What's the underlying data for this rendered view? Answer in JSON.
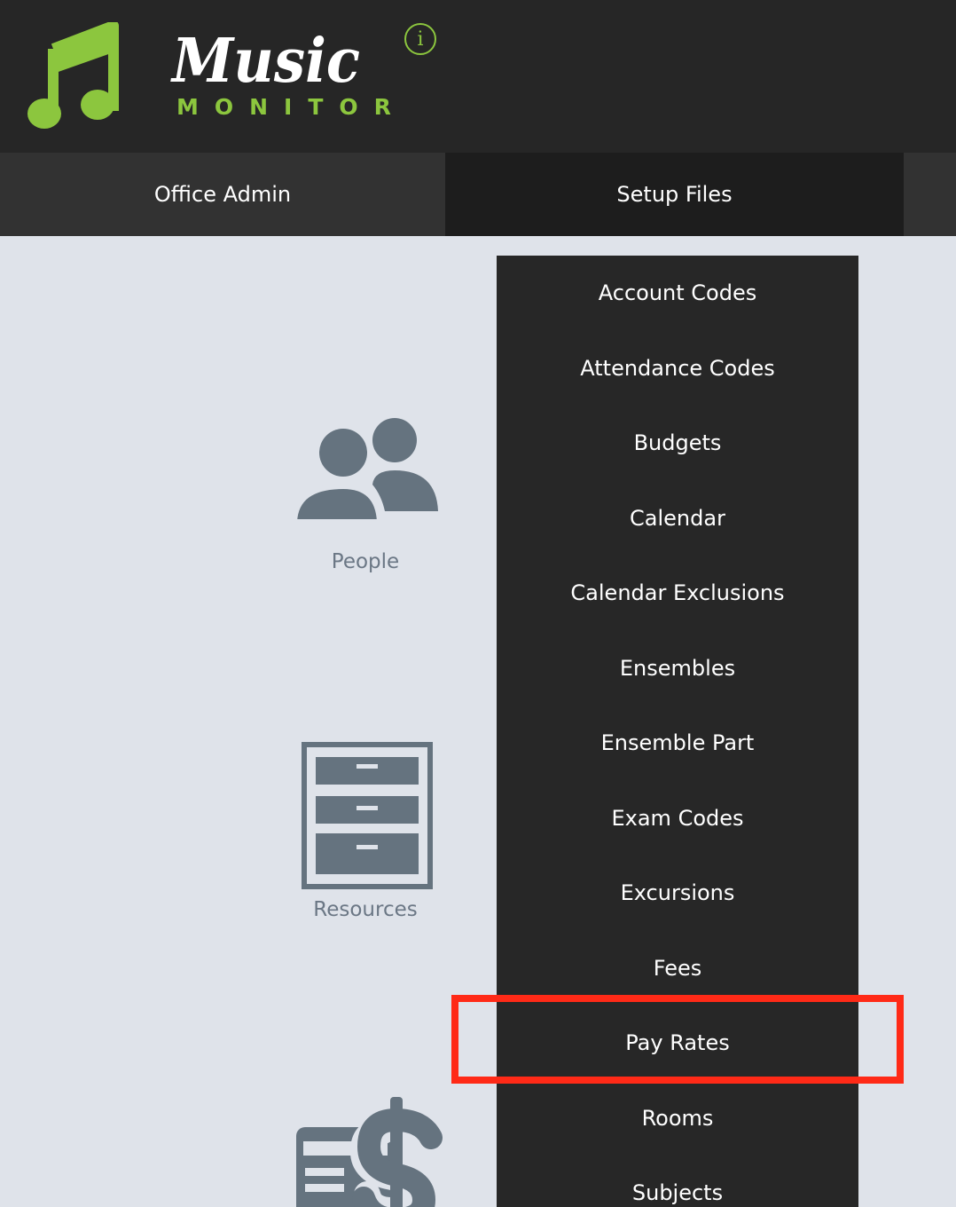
{
  "header": {
    "logo_word": "Music",
    "logo_sub": "MONITOR",
    "info_glyph": "i",
    "icons": [
      "music-note-icon",
      "info-icon"
    ]
  },
  "nav": {
    "tabs": [
      {
        "label": "Office Admin"
      },
      {
        "label": "Setup Files"
      }
    ]
  },
  "tiles": [
    {
      "label": "People",
      "icon": "people-icon"
    },
    {
      "label": "Resources",
      "icon": "filing-cabinet-icon"
    },
    {
      "label": "",
      "icon": "invoice-dollar-icon"
    }
  ],
  "dropdown": {
    "items": [
      {
        "label": "Account Codes"
      },
      {
        "label": "Attendance Codes"
      },
      {
        "label": "Budgets"
      },
      {
        "label": "Calendar"
      },
      {
        "label": "Calendar Exclusions"
      },
      {
        "label": "Ensembles"
      },
      {
        "label": "Ensemble Part"
      },
      {
        "label": "Exam Codes"
      },
      {
        "label": "Excursions"
      },
      {
        "label": "Fees"
      },
      {
        "label": "Pay Rates",
        "highlighted": true
      },
      {
        "label": "Rooms"
      },
      {
        "label": "Subjects"
      }
    ]
  },
  "colors": {
    "header_bg": "#262626",
    "brand_green": "#8cc63e",
    "page_bg": "#dfe3ea",
    "icon_gray": "#65737f",
    "dropdown_bg": "#272727",
    "highlight": "#ff2a17"
  }
}
